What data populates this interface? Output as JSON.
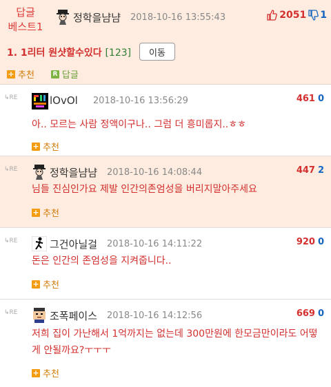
{
  "best": {
    "label_line1": "답글",
    "label_line2": "베스트1",
    "nick": "정학을냠냠",
    "date": "2018-10-16 13:55:43",
    "up": "2051",
    "down": "1",
    "title": "1. 1리터 원샷할수있다",
    "title_count": "[123]",
    "move_button": "이동",
    "recommend_label": "추천",
    "reply_label": "답글",
    "avatar_icon": "gentleman-avatar-icon"
  },
  "comments": [
    {
      "nick": "lOvOl",
      "date": "2018-10-16 13:56:29",
      "up": "461",
      "down": "0",
      "text": "아.. 모르는 사람 정액이구나.. 그럼 더 흥미롭지..ㅎㅎ",
      "action": "추천",
      "re": "RE",
      "avatar_icon": "rainbow-text-avatar-icon",
      "mine": false
    },
    {
      "nick": "정학을냠냠",
      "date": "2018-10-16 14:08:44",
      "up": "447",
      "down": "2",
      "text": "님들 진심인가요 제발 인간의존엄성을 버리지말아주세요",
      "action": "추천",
      "re": "RE",
      "avatar_icon": "gentleman-avatar-icon",
      "mine": true
    },
    {
      "nick": "그건아닐걸",
      "date": "2018-10-16 14:11:22",
      "up": "920",
      "down": "0",
      "text": "돈은 인간의 존엄성을 지켜줍니다..",
      "action": "추천",
      "re": "RE",
      "avatar_icon": "running-figure-avatar-icon",
      "mine": false
    },
    {
      "nick": "조폭페이스",
      "date": "2018-10-16 14:12:56",
      "up": "669",
      "down": "0",
      "text": "저희 집이 가난해서 1억까지는 없는데 300만원에 한모금만이라도 어떻게 안될까요?ㅜㅜㅜ",
      "action": "추천",
      "re": "RE",
      "avatar_icon": "pixel-face-avatar-icon",
      "mine": false
    }
  ]
}
